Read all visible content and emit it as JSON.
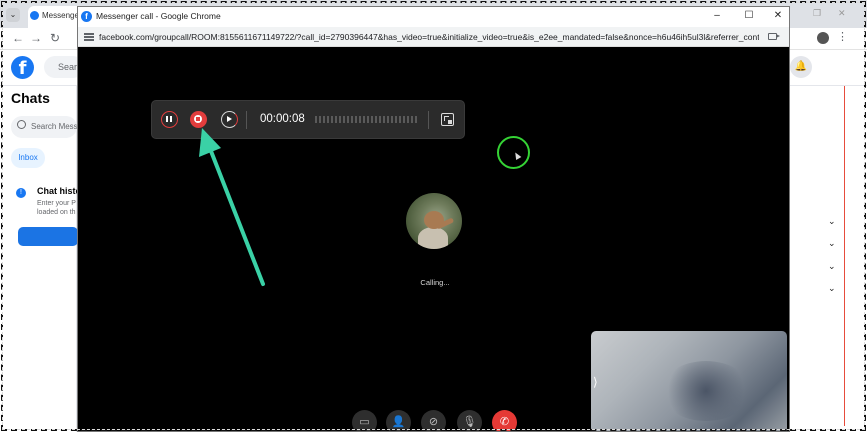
{
  "background_window": {
    "tab_title": "Messenger",
    "search_placeholder": "Search",
    "chats_title": "Chats",
    "chat_search_placeholder": "Search Messenger",
    "inbox_label": "Inbox",
    "history_title": "Chat history",
    "history_sub_line1": "Enter your P",
    "history_sub_line2": "loaded on th",
    "nav_back": "←",
    "nav_forward": "→",
    "nav_reload": "↻",
    "tab_dropdown": "⌄",
    "right_icon": "🔔",
    "menu_icon": "⋮"
  },
  "call_window": {
    "title": "Messenger call - Google Chrome",
    "url": "facebook.com/groupcall/ROOM:8155611671149722/?call_id=2790396447&has_video=true&initialize_video=true&is_e2ee_mandated=false&nonce=h6u46ih5ul3l&referrer_context=zenon_prec...",
    "minimize": "–",
    "maximize": "☐",
    "close": "✕"
  },
  "recorder": {
    "elapsed_time": "00:00:08"
  },
  "call": {
    "status_text": "Calling..."
  },
  "controls": {
    "share_screen": "▭",
    "add_person": "👤",
    "video_off": "⊘",
    "mute": "🎙",
    "end_call": "✆"
  },
  "colors": {
    "facebook_blue": "#1877f2",
    "record_red": "#e23d3d",
    "annotation_teal": "#3ad1a6",
    "cursor_ring_green": "#35d335",
    "end_call_red": "#e53935"
  }
}
